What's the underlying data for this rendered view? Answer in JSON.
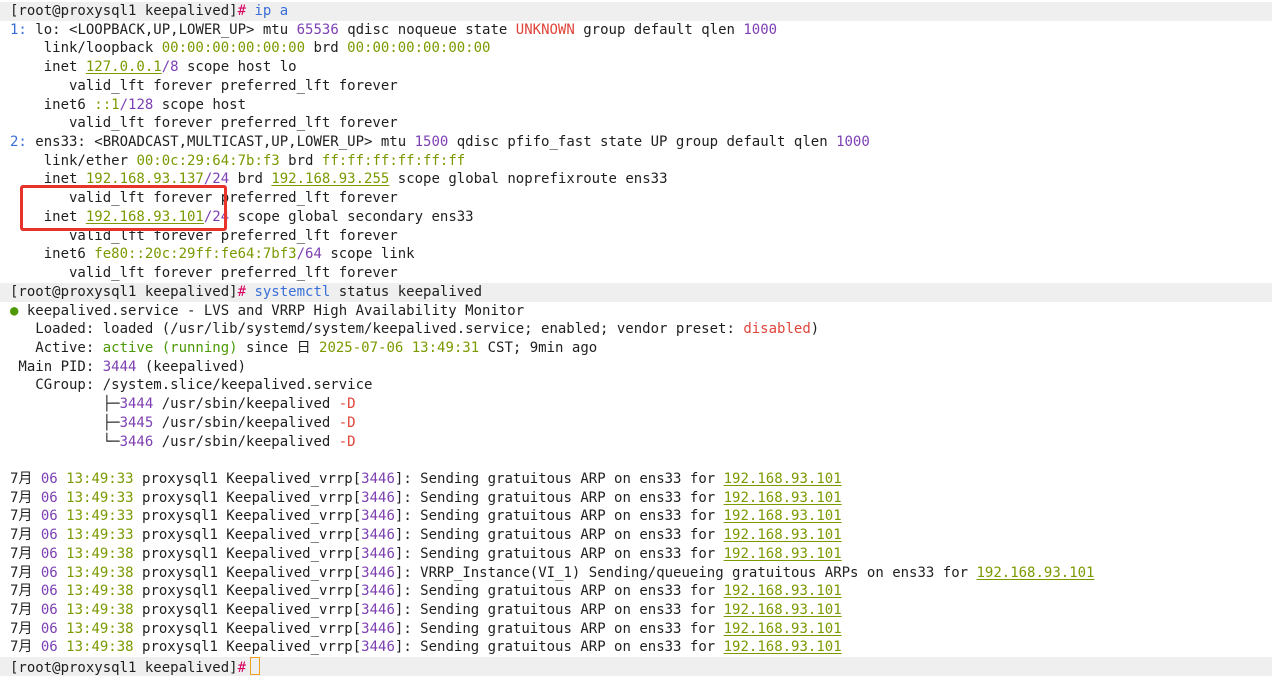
{
  "prompt": "[root@proxysql1 keepalived]",
  "prompt_sep": "#",
  "commands": {
    "ip": "ip a",
    "systemctl_cmd": "systemctl",
    "systemctl_args": " status keepalived"
  },
  "iface_lo": {
    "idx": "1:",
    "name": " lo: ",
    "flags": "<LOOPBACK,UP,LOWER_UP>",
    "mtu_label": " mtu ",
    "mtu": "65536",
    "qdisc_text": " qdisc noqueue state ",
    "state": "UNKNOWN",
    "group_text": " group default qlen ",
    "qlen": "1000",
    "link_text": "    link/loopback ",
    "mac": "00:00:00:00:00:00",
    "brd_text": " brd ",
    "brd": "00:00:00:00:00:00",
    "inet_text": "    inet ",
    "inet_addr": "127.0.0.1",
    "inet_prefix": "/8",
    "inet_scope": " scope host lo",
    "valid1": "       valid_lft forever preferred_lft forever",
    "inet6_text": "    inet6 ",
    "inet6_addr": "::1",
    "inet6_prefix": "/128",
    "inet6_scope": " scope host",
    "valid2": "       valid_lft forever preferred_lft forever"
  },
  "iface_ens33": {
    "idx": "2:",
    "name": " ens33: ",
    "flags": "<BROADCAST,MULTICAST,UP,LOWER_UP>",
    "mtu_label": " mtu ",
    "mtu": "1500",
    "qdisc_text": " qdisc pfifo_fast state UP group default qlen ",
    "qlen": "1000",
    "link_text": "    link/ether ",
    "mac": "00:0c:29:64:7b:f3",
    "brd_text": " brd ",
    "brd": "ff:ff:ff:ff:ff:ff",
    "inet1_text": "    inet ",
    "inet1_addr": "192.168.93.137",
    "inet1_prefix": "/24",
    "inet1_brd_text": " brd ",
    "inet1_brd": "192.168.93.255",
    "inet1_scope": " scope global noprefixroute ens33",
    "valid1": "       valid_lft forever preferred_lft forever",
    "inet2_text": "    inet ",
    "inet2_addr": "192.168.93.101",
    "inet2_prefix": "/24",
    "inet2_scope": " scope global secondary ens33",
    "valid2": "       valid_lft forever preferred_lft forever",
    "inet6_text": "    inet6 ",
    "inet6_addr": "fe80::20c:29ff:fe64:7bf3",
    "inet6_prefix": "/64",
    "inet6_scope": " scope link",
    "valid3": "       valid_lft forever preferred_lft forever"
  },
  "status": {
    "dot": "●",
    "title": " keepalived.service - LVS and VRRP High Availability Monitor",
    "loaded_label": "   Loaded: ",
    "loaded_value": "loaded (/usr/lib/systemd/system/keepalived.service; enabled; vendor preset: ",
    "preset": "disabled",
    "loaded_end": ")",
    "active_label": "   Active: ",
    "active_value": "active (running)",
    "since_text": " since ",
    "since_glyph": "日",
    "since_date": " 2025-07-06 13:49:31",
    "since_rest": " CST; 9min ago",
    "pid_label": " Main PID: ",
    "pid": "3444",
    "pid_name": " (keepalived)",
    "cgroup_label": "   CGroup: ",
    "cgroup_value": "/system.slice/keepalived.service",
    "procs": [
      {
        "tree": "           ├─",
        "pid": "3444",
        "cmd": " /usr/sbin/keepalived ",
        "flag": "-D"
      },
      {
        "tree": "           ├─",
        "pid": "3445",
        "cmd": " /usr/sbin/keepalived ",
        "flag": "-D"
      },
      {
        "tree": "           └─",
        "pid": "3446",
        "cmd": " /usr/sbin/keepalived ",
        "flag": "-D"
      }
    ]
  },
  "logs": [
    {
      "month": "7月",
      "day": " 06",
      "time": " 13:49:33",
      "host": " proxysql1 Keepalived_vrrp[",
      "pid": "3446",
      "close": "]",
      "msg": ": Sending gratuitous ARP on ens33 for ",
      "ip": "192.168.93.101"
    },
    {
      "month": "7月",
      "day": " 06",
      "time": " 13:49:33",
      "host": " proxysql1 Keepalived_vrrp[",
      "pid": "3446",
      "close": "]",
      "msg": ": Sending gratuitous ARP on ens33 for ",
      "ip": "192.168.93.101"
    },
    {
      "month": "7月",
      "day": " 06",
      "time": " 13:49:33",
      "host": " proxysql1 Keepalived_vrrp[",
      "pid": "3446",
      "close": "]",
      "msg": ": Sending gratuitous ARP on ens33 for ",
      "ip": "192.168.93.101"
    },
    {
      "month": "7月",
      "day": " 06",
      "time": " 13:49:33",
      "host": " proxysql1 Keepalived_vrrp[",
      "pid": "3446",
      "close": "]",
      "msg": ": Sending gratuitous ARP on ens33 for ",
      "ip": "192.168.93.101"
    },
    {
      "month": "7月",
      "day": " 06",
      "time": " 13:49:38",
      "host": " proxysql1 Keepalived_vrrp[",
      "pid": "3446",
      "close": "]",
      "msg": ": Sending gratuitous ARP on ens33 for ",
      "ip": "192.168.93.101"
    },
    {
      "month": "7月",
      "day": " 06",
      "time": " 13:49:38",
      "host": " proxysql1 Keepalived_vrrp[",
      "pid": "3446",
      "close": "]",
      "msg": ": VRRP_Instance(VI_1) Sending/queueing gratuitous ARPs on ens33 for ",
      "ip": "192.168.93.101"
    },
    {
      "month": "7月",
      "day": " 06",
      "time": " 13:49:38",
      "host": " proxysql1 Keepalived_vrrp[",
      "pid": "3446",
      "close": "]",
      "msg": ": Sending gratuitous ARP on ens33 for ",
      "ip": "192.168.93.101"
    },
    {
      "month": "7月",
      "day": " 06",
      "time": " 13:49:38",
      "host": " proxysql1 Keepalived_vrrp[",
      "pid": "3446",
      "close": "]",
      "msg": ": Sending gratuitous ARP on ens33 for ",
      "ip": "192.168.93.101"
    },
    {
      "month": "7月",
      "day": " 06",
      "time": " 13:49:38",
      "host": " proxysql1 Keepalived_vrrp[",
      "pid": "3446",
      "close": "]",
      "msg": ": Sending gratuitous ARP on ens33 for ",
      "ip": "192.168.93.101"
    },
    {
      "month": "7月",
      "day": " 06",
      "time": " 13:49:38",
      "host": " proxysql1 Keepalived_vrrp[",
      "pid": "3446",
      "close": "]",
      "msg": ": Sending gratuitous ARP on ens33 for ",
      "ip": "192.168.93.101"
    }
  ],
  "colors": {
    "highlight_box": "#e8332a",
    "prompt_bg": "#efefef",
    "cursor": "#f0a020"
  }
}
